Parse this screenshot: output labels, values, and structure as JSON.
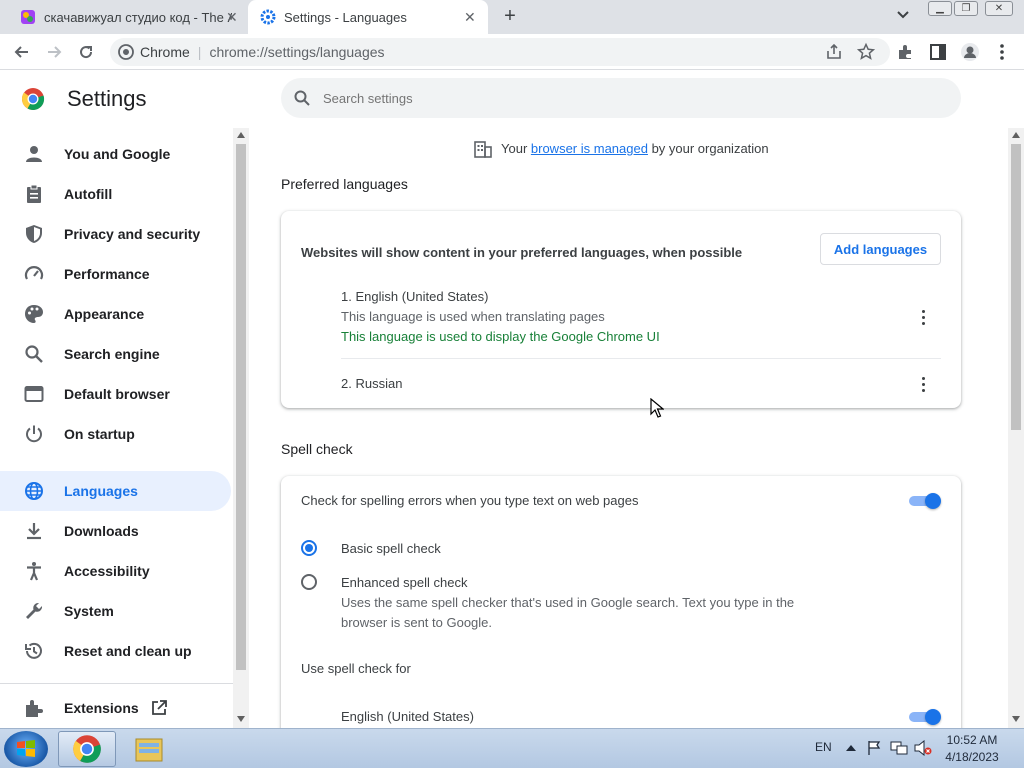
{
  "tabs": [
    {
      "title": "скачавижуал студио код - The А",
      "active": false
    },
    {
      "title": "Settings - Languages",
      "active": true
    }
  ],
  "toolbar": {
    "site_label": "Chrome",
    "url": "chrome://settings/languages"
  },
  "settings": {
    "title": "Settings",
    "search_placeholder": "Search settings"
  },
  "sidebar": {
    "items": [
      {
        "label": "You and Google",
        "icon": "person-icon"
      },
      {
        "label": "Autofill",
        "icon": "clipboard-icon"
      },
      {
        "label": "Privacy and security",
        "icon": "shield-icon"
      },
      {
        "label": "Performance",
        "icon": "gauge-icon"
      },
      {
        "label": "Appearance",
        "icon": "palette-icon"
      },
      {
        "label": "Search engine",
        "icon": "search-icon"
      },
      {
        "label": "Default browser",
        "icon": "browser-icon"
      },
      {
        "label": "On startup",
        "icon": "power-icon"
      },
      {
        "label": "Languages",
        "icon": "globe-icon",
        "active": true
      },
      {
        "label": "Downloads",
        "icon": "download-icon"
      },
      {
        "label": "Accessibility",
        "icon": "accessibility-icon"
      },
      {
        "label": "System",
        "icon": "wrench-icon"
      },
      {
        "label": "Reset and clean up",
        "icon": "history-icon"
      }
    ],
    "extensions_label": "Extensions"
  },
  "managed_notice": {
    "prefix": "Your ",
    "link": "browser is managed",
    "suffix": " by your organization"
  },
  "preferred_languages": {
    "section_title": "Preferred languages",
    "description": "Websites will show content in your preferred languages, when possible",
    "add_button": "Add languages",
    "languages": [
      {
        "name": "1. English (United States)",
        "note1": "This language is used when translating pages",
        "note2": "This language is used to display the Google Chrome UI"
      },
      {
        "name": "2. Russian"
      }
    ]
  },
  "spell_check": {
    "section_title": "Spell check",
    "toggle_label": "Check for spelling errors when you type text on web pages",
    "toggle_on": true,
    "basic_label": "Basic spell check",
    "basic_selected": true,
    "enhanced_label": "Enhanced spell check",
    "enhanced_desc_line1": "Uses the same spell checker that's used in Google search. Text you type in the",
    "enhanced_desc_line2": "browser is sent to Google.",
    "use_for_label": "Use spell check for",
    "language_label": "English (United States)",
    "language_on": true
  },
  "taskbar": {
    "lang": "EN",
    "time": "10:52 AM",
    "date": "4/18/2023"
  },
  "colors": {
    "accent": "#1a73e8",
    "green": "#188038",
    "active_nav_bg": "#e8f0fe"
  }
}
